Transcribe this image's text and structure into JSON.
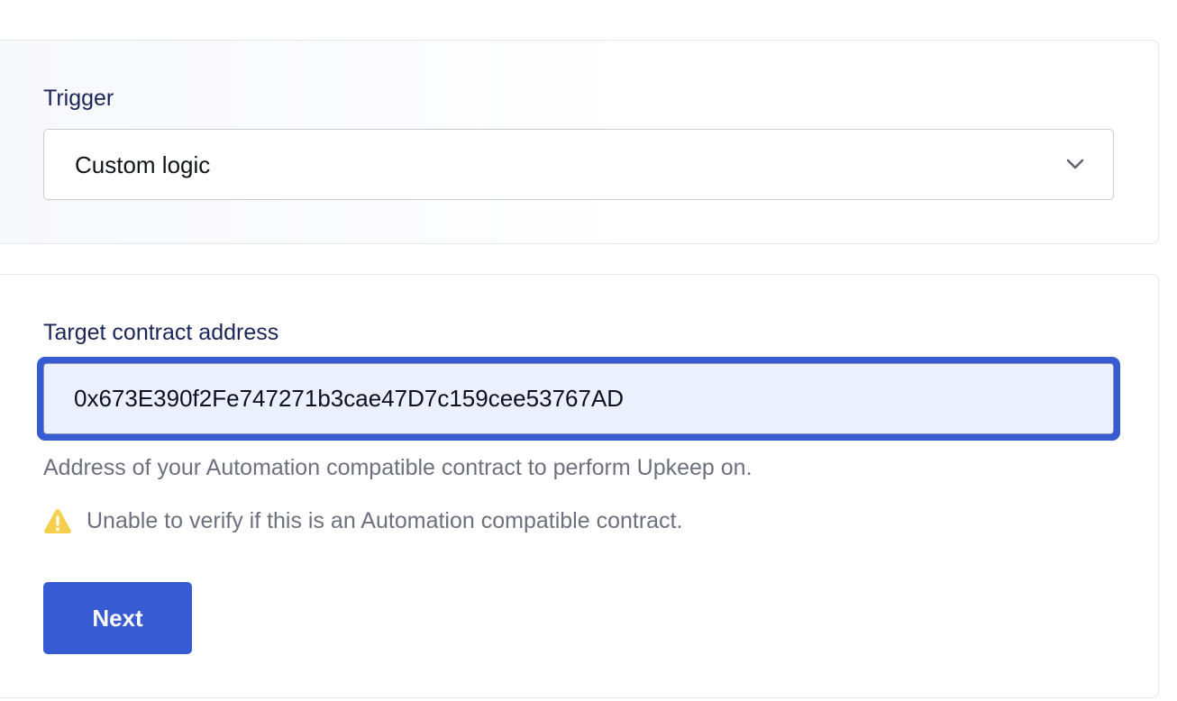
{
  "trigger": {
    "label": "Trigger",
    "selected": "Custom logic",
    "dropdown_icon": "chevron-down-icon"
  },
  "target": {
    "label": "Target contract address",
    "value": "0x673E390f2Fe747271b3cae47D7c159cee53767AD",
    "help_text": "Address of your Automation compatible contract to perform Upkeep on.",
    "warning_icon": "warning-icon",
    "warning_text": "Unable to verify if this is an Automation compatible contract."
  },
  "actions": {
    "next_label": "Next"
  },
  "colors": {
    "accent": "#375bd2",
    "label": "#1b2559",
    "muted_text": "#6c717d",
    "warning": "#f5cf4b",
    "input_bg": "#ebf0fd"
  }
}
